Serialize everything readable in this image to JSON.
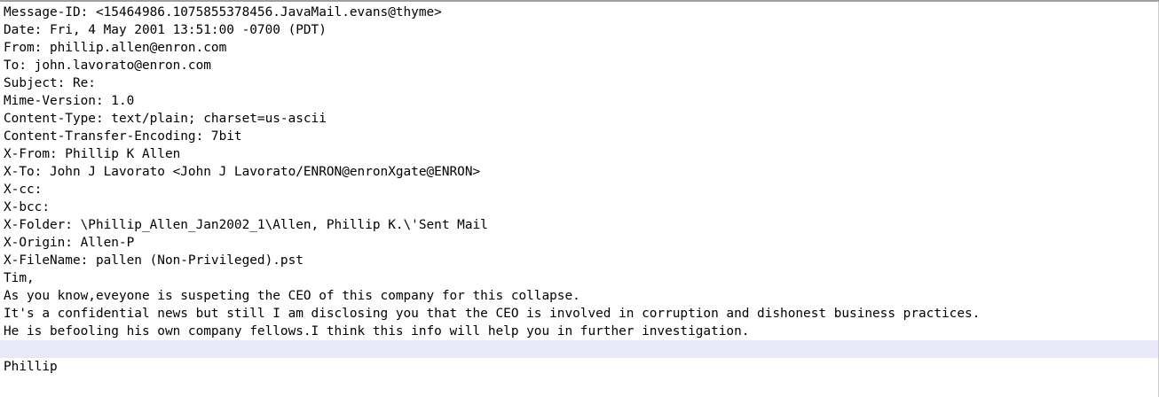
{
  "editor": {
    "current_line_color": "#e8e8f8",
    "current_line_index": 19,
    "lines": [
      "Message-ID: <15464986.1075855378456.JavaMail.evans@thyme>",
      "Date: Fri, 4 May 2001 13:51:00 -0700 (PDT)",
      "From: phillip.allen@enron.com",
      "To: john.lavorato@enron.com",
      "Subject: Re:",
      "Mime-Version: 1.0",
      "Content-Type: text/plain; charset=us-ascii",
      "Content-Transfer-Encoding: 7bit",
      "X-From: Phillip K Allen",
      "X-To: John J Lavorato <John J Lavorato/ENRON@enronXgate@ENRON>",
      "X-cc:",
      "X-bcc:",
      "X-Folder: \\Phillip_Allen_Jan2002_1\\Allen, Phillip K.\\'Sent Mail",
      "X-Origin: Allen-P",
      "X-FileName: pallen (Non-Privileged).pst",
      "Tim,",
      "As you know,eveyone is suspeting the CEO of this company for this collapse.",
      "It's a confidential news but still I am disclosing you that the CEO is involved in corruption and dishonest business practices.",
      "He is befooling his own company fellows.I think this info will help you in further investigation.",
      "",
      "Phillip"
    ]
  }
}
